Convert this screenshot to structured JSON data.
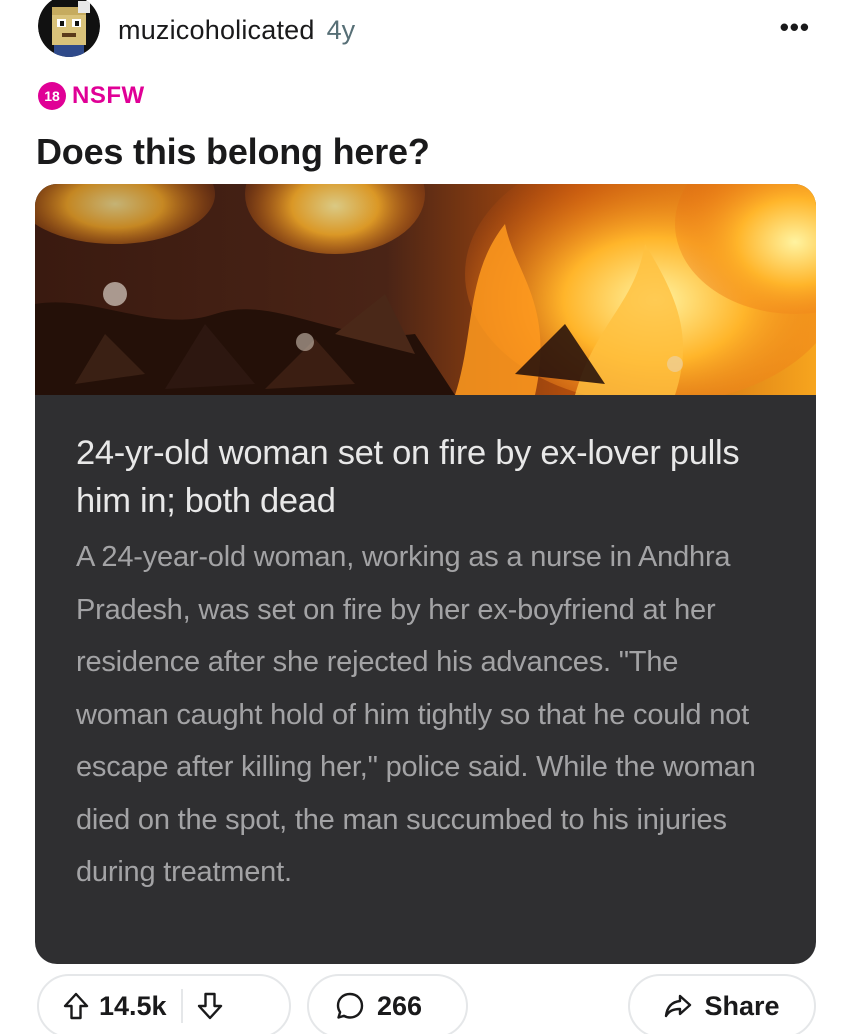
{
  "post": {
    "author": "muzicoholicated",
    "age": "4y",
    "more_icon": "ellipsis-icon",
    "nsfw_badge": "18",
    "nsfw_label": "NSFW",
    "title": "Does this belong here?"
  },
  "link_card": {
    "image_icon": "fire-image",
    "headline": "24-yr-old woman set on fire by ex-lover pulls him in; both dead",
    "summary": "A 24-year-old woman, working as a nurse in Andhra Pradesh, was set on fire by her ex-boyfriend at her residence after she rejected his advances. \"The woman caught hold of him tightly so that he could not escape after killing her,\" police said. While the woman died on the spot, the man succumbed to his injuries during treatment."
  },
  "actions": {
    "score": "14.5k",
    "comments": "266",
    "share_label": "Share",
    "upvote_icon": "upvote-arrow-icon",
    "downvote_icon": "downvote-arrow-icon",
    "comment_icon": "comment-bubble-icon",
    "share_icon": "share-arrow-icon"
  },
  "colors": {
    "nsfw": "#e00096",
    "card_background": "#2f2f31",
    "headline_text": "#e8e8e8",
    "summary_text": "#a3a3a5",
    "pill_border": "#e5e7e9"
  }
}
